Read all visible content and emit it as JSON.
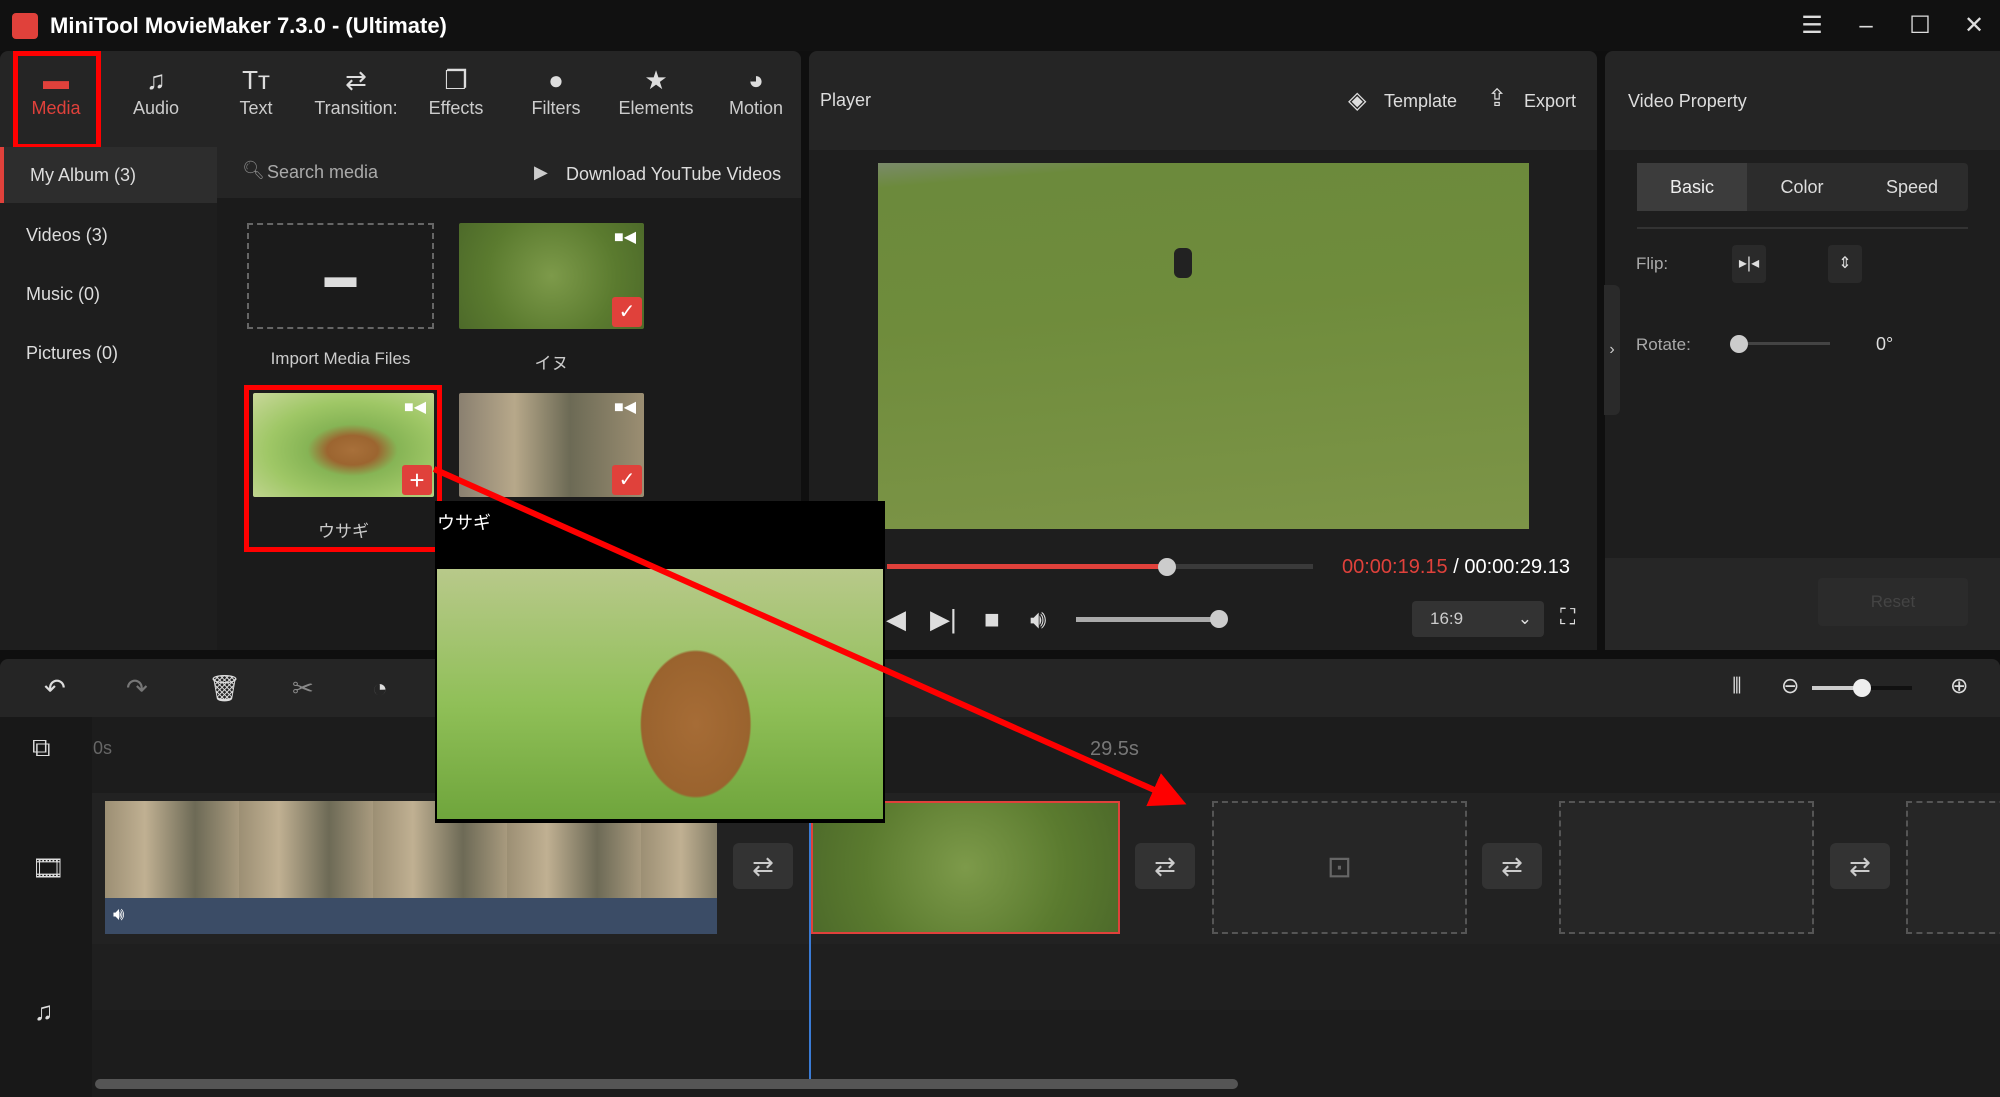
{
  "app": {
    "title": "MiniTool MovieMaker 7.3.0 - (Ultimate)"
  },
  "window_controls": [
    "menu-icon",
    "minimize-icon",
    "maximize-icon",
    "close-icon"
  ],
  "toolbar": [
    {
      "label": "Media",
      "icon": "folder-icon",
      "active": true
    },
    {
      "label": "Audio",
      "icon": "music-icon"
    },
    {
      "label": "Text",
      "icon": "text-icon"
    },
    {
      "label": "Transition:",
      "icon": "swap-icon"
    },
    {
      "label": "Effects",
      "icon": "layers-icon"
    },
    {
      "label": "Filters",
      "icon": "filters-icon"
    },
    {
      "label": "Elements",
      "icon": "elements-icon"
    },
    {
      "label": "Motion",
      "icon": "motion-icon"
    }
  ],
  "sidebar": {
    "items": [
      {
        "label": "My Album (3)",
        "active": true
      },
      {
        "label": "Videos (3)"
      },
      {
        "label": "Music (0)"
      },
      {
        "label": "Pictures (0)"
      }
    ]
  },
  "media": {
    "search_placeholder": "Search media",
    "download_label": "Download YouTube Videos",
    "import_label": "Import Media Files",
    "items": [
      {
        "label": "イヌ",
        "added": true
      },
      {
        "label": "ウサギ",
        "added": false
      },
      {
        "label": "",
        "added": true
      }
    ]
  },
  "drag_preview": {
    "label": "ウサギ"
  },
  "player": {
    "title": "Player",
    "template_label": "Template",
    "export_label": "Export",
    "current_time": "00:00:19.15",
    "total_time": "00:00:29.13",
    "separator": " / ",
    "progress_fraction": 0.657,
    "volume_fraction": 0.95,
    "aspect_ratio": "16:9"
  },
  "property": {
    "title": "Video Property",
    "tabs": [
      "Basic",
      "Color",
      "Speed"
    ],
    "active_tab": "Basic",
    "flip_label": "Flip:",
    "rotate_label": "Rotate:",
    "rotate_value": "0°",
    "reset_label": "Reset"
  },
  "timeline": {
    "ruler": [
      "0s",
      "29.5s"
    ],
    "zoom_fraction": 0.5
  },
  "colors": {
    "accent": "#e0413b",
    "highlight": "#ff0000"
  }
}
